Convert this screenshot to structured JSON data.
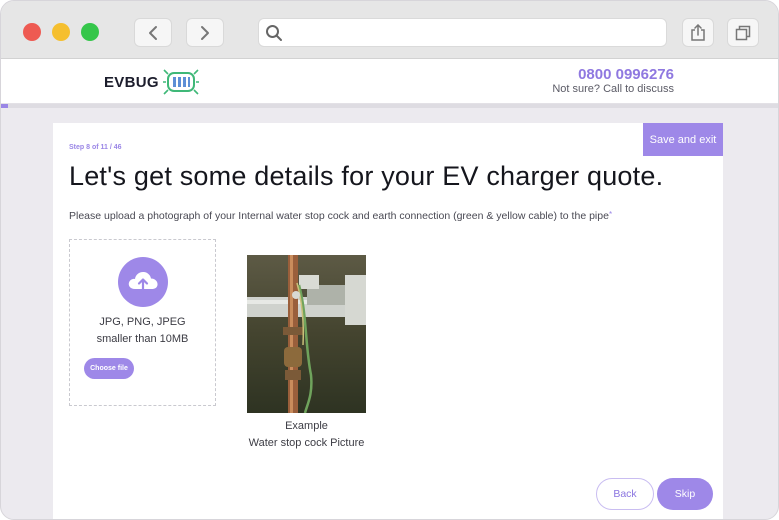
{
  "browser": {
    "url": "",
    "icons": {
      "back": "chevron-left-icon",
      "forward": "chevron-right-icon",
      "search": "search-icon",
      "share": "share-icon",
      "tabs": "tabs-icon"
    }
  },
  "header": {
    "logo_text": "EVBUG",
    "phone": "0800 0996276",
    "discuss": "Not sure? Call to discuss"
  },
  "progress": {
    "fraction": 0.0022
  },
  "form": {
    "save_exit": "Save and exit",
    "step": "Step 8 of 11 / 46",
    "heading": "Let's get some details for your EV charger quote.",
    "instruction": "Please upload a photograph of your Internal water stop cock and earth connection (green & yellow cable) to the pipe",
    "required_mark": "*",
    "upload": {
      "formats": "JPG, PNG, JPEG",
      "size": "smaller than 10MB",
      "choose_label": "Choose file"
    },
    "example": {
      "label": "Example",
      "caption": "Water stop cock Picture"
    },
    "back_label": "Back",
    "skip_label": "Skip"
  },
  "colors": {
    "accent": "#9e88e8",
    "heading": "#15161d",
    "phone": "#8f78e0"
  }
}
